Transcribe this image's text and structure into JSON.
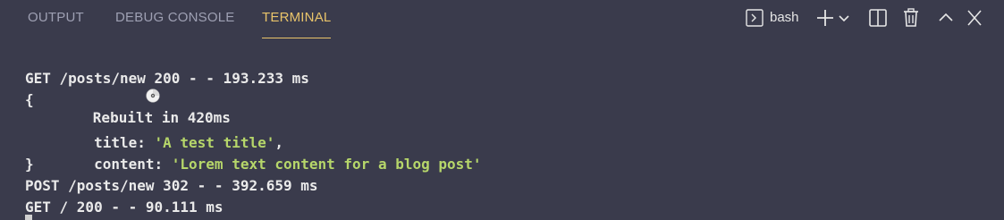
{
  "tabs": {
    "output": "OUTPUT",
    "debug_console": "DEBUG CONSOLE",
    "terminal": "TERMINAL"
  },
  "actions": {
    "shell_name": "bash"
  },
  "terminal": {
    "rebuilt": "Rebuilt in 420ms",
    "get_new": "GET /posts/new 200 - - 193.233 ms",
    "open_brace": "{",
    "title_key": "  title: ",
    "title_value": "'A test title'",
    "title_comma": ",",
    "content_key": "  content: ",
    "content_value": "'Lorem text content for a blog post'",
    "close_brace": "}",
    "post_new": "POST /posts/new 302 - - 392.659 ms",
    "get_root": "GET / 200 - - 90.111 ms"
  },
  "colors": {
    "background": "#3a3b4c",
    "active_tab": "#e9c46a",
    "inactive_tab": "#9ea0b3",
    "string": "#b6d66a",
    "text": "#eaeaea"
  },
  "icons": {
    "rebuilt": "cd-icon",
    "shell": "terminal-shell-icon",
    "new_terminal": "plus-icon",
    "dropdown": "chevron-down-icon",
    "split": "split-terminal-icon",
    "kill": "trash-icon",
    "maximize": "chevron-up-icon",
    "close": "close-icon"
  }
}
